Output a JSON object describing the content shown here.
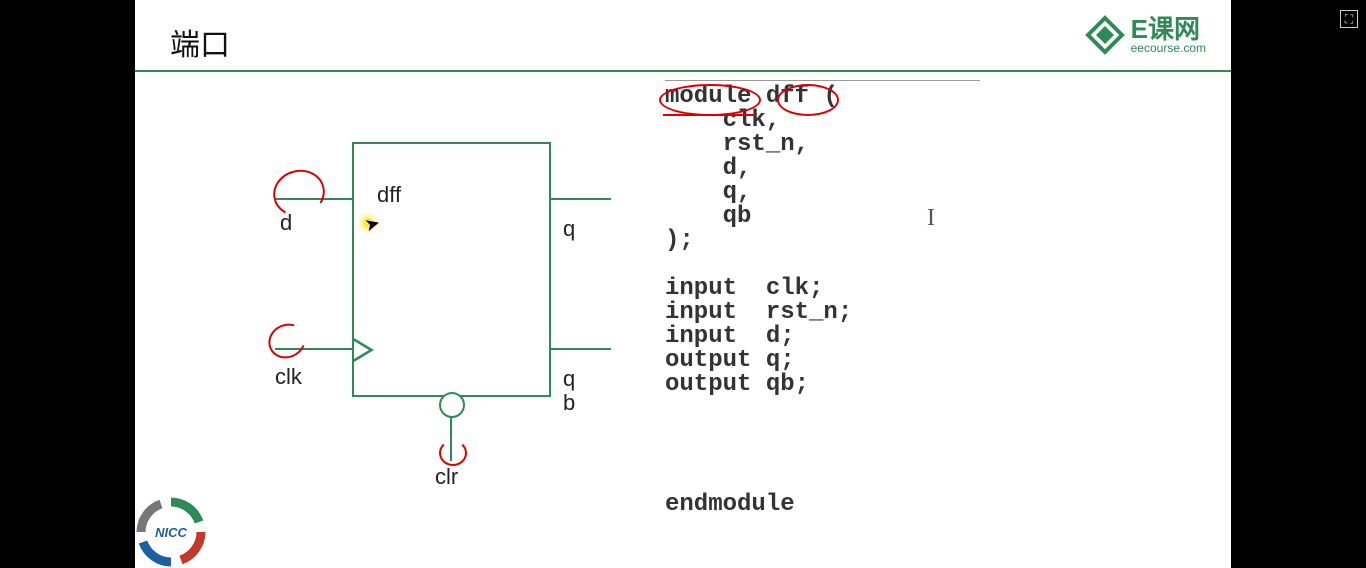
{
  "title": "端口",
  "logo": {
    "cn": "E课网",
    "url": "eecourse.com"
  },
  "diagram": {
    "name": "dff",
    "ports": {
      "d": "d",
      "clk": "clk",
      "clr": "clr",
      "q": "q",
      "qb_top": "q",
      "qb_bottom": "b"
    }
  },
  "code": {
    "l1a": "module",
    "l1b": " ",
    "l1c": "dff",
    "l1d": " (",
    "l2": "    clk,",
    "l3": "    rst_n,",
    "l4": "    d,",
    "l5": "    q,",
    "l6": "    qb",
    "l7": ");",
    "blank": " ",
    "l8": "input  clk;",
    "l9": "input  rst_n;",
    "l10": "input  d;",
    "l11": "output q;",
    "l12": "output qb;",
    "l13": "endmodule"
  }
}
